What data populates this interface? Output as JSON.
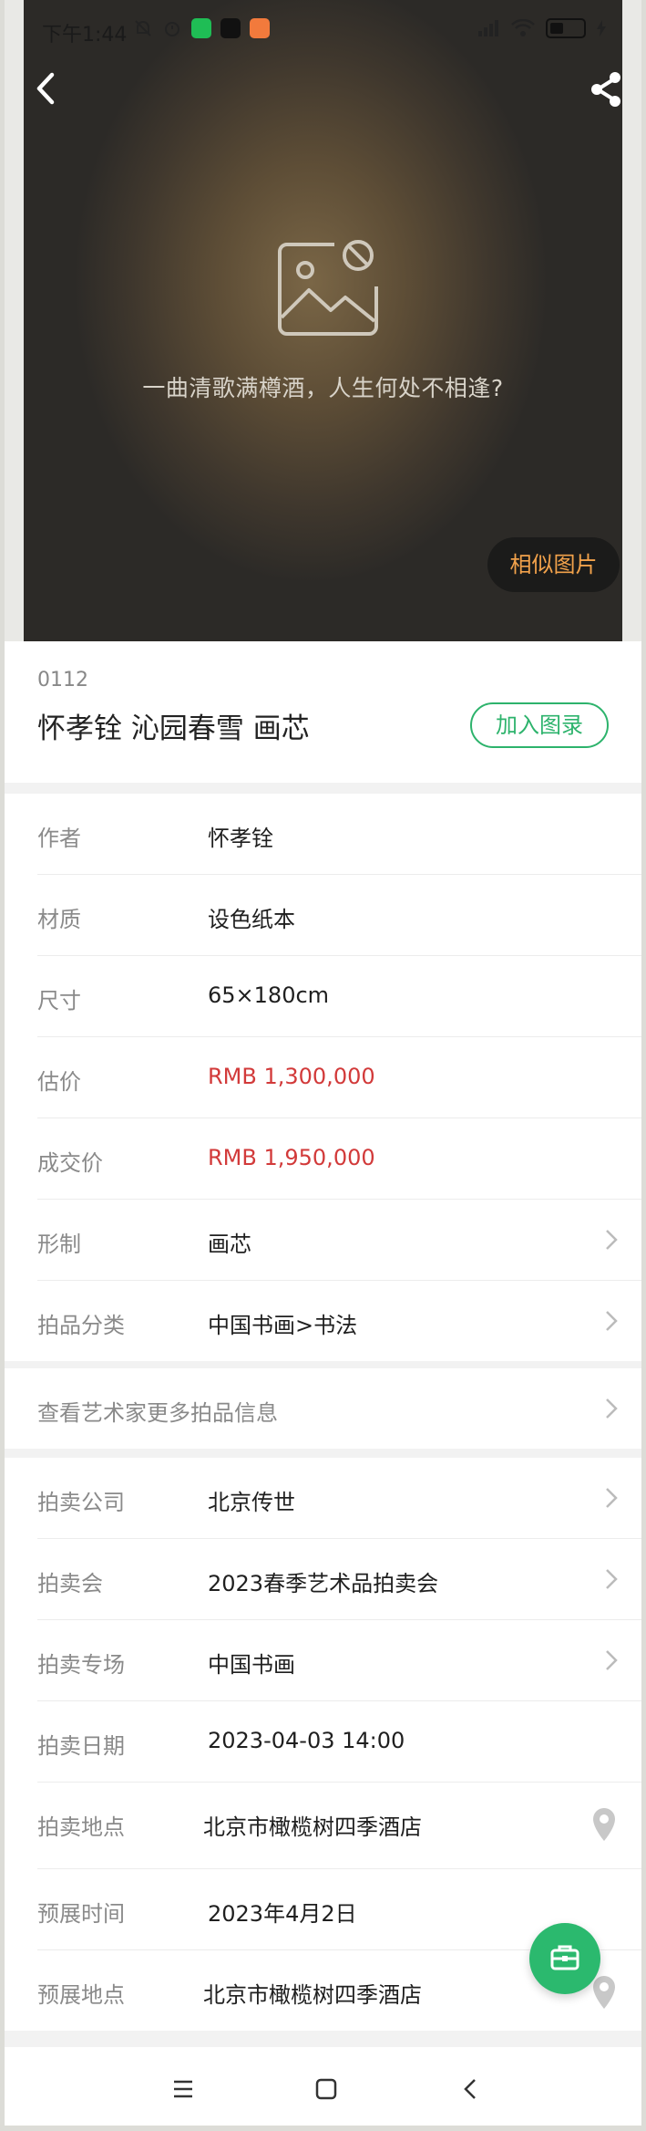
{
  "status_bar": {
    "time": "下午1:44",
    "battery_level": "60",
    "icons": [
      "mute-bell-icon",
      "alarm-icon",
      "wechat-icon",
      "tiktok-icon",
      "app-icon",
      "signal-icon",
      "wifi-icon",
      "battery-icon",
      "charging-icon"
    ]
  },
  "header": {
    "back_icon": "chevron-left-icon",
    "share_icon": "share-icon"
  },
  "hero": {
    "placeholder_icon": "broken-image-icon",
    "caption": "一曲清歌满樽酒，人生何处不相逢?",
    "similar_button": "相似图片"
  },
  "lot": {
    "number": "0112",
    "title": "怀孝铨 沁园春雪 画芯",
    "catalog_button": "加入图录"
  },
  "details": [
    {
      "label": "作者",
      "value": " 怀孝铨",
      "red": false,
      "chevron": false
    },
    {
      "label": "材质",
      "value": "设色纸本",
      "red": false,
      "chevron": false
    },
    {
      "label": "尺寸",
      "value": "65×180cm",
      "red": false,
      "chevron": false
    },
    {
      "label": "估价",
      "value": "RMB  1,300,000",
      "red": true,
      "chevron": false
    },
    {
      "label": "成交价",
      "value": "RMB 1,950,000",
      "red": true,
      "chevron": false
    },
    {
      "label": "形制",
      "value": "画芯",
      "red": false,
      "chevron": true
    },
    {
      "label": "拍品分类",
      "value": "中国书画>书法",
      "red": false,
      "chevron": true
    }
  ],
  "more_link": "查看艺术家更多拍品信息",
  "auction": [
    {
      "label": "拍卖公司",
      "value": "北京传世",
      "chevron": true,
      "pin": false
    },
    {
      "label": "拍卖会",
      "value": "2023春季艺术品拍卖会",
      "chevron": true,
      "pin": false
    },
    {
      "label": "拍卖专场",
      "value": "中国书画",
      "chevron": true,
      "pin": false
    },
    {
      "label": "拍卖日期",
      "value": "2023-04-03 14:00",
      "chevron": false,
      "pin": false
    },
    {
      "label": "拍卖地点",
      "value": "北京市橄榄树四季酒店",
      "chevron": false,
      "pin": true
    },
    {
      "label": "预展时间",
      "value": "2023年4月2日",
      "chevron": false,
      "pin": false
    },
    {
      "label": "预展地点",
      "value": "北京市橄榄树四季酒店",
      "chevron": false,
      "pin": true
    }
  ],
  "fab_icon": "briefcase-icon",
  "nav": {
    "icons": [
      "menu-icon",
      "home-square-icon",
      "back-triangle-icon"
    ]
  },
  "colors": {
    "accent_green": "#2db36c",
    "price_red": "#d23a3a",
    "similar_orange": "#f2a24b"
  }
}
